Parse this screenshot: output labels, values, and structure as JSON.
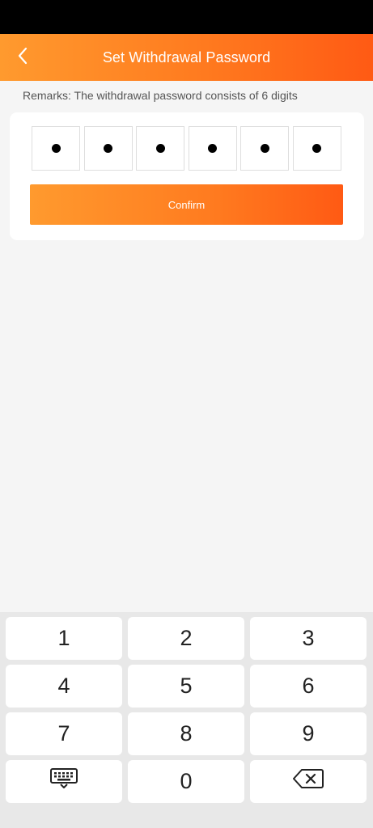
{
  "header": {
    "title": "Set Withdrawal Password"
  },
  "remarks": "Remarks: The withdrawal password consists of 6 digits",
  "pin": {
    "length": 6,
    "filled": 6,
    "mask_char": "●"
  },
  "confirm_label": "Confirm",
  "keypad": {
    "rows": [
      [
        "1",
        "2",
        "3"
      ],
      [
        "4",
        "5",
        "6"
      ],
      [
        "7",
        "8",
        "9"
      ],
      [
        "keyboard-icon",
        "0",
        "backspace-icon"
      ]
    ]
  },
  "colors": {
    "accent_start": "#ff9a2e",
    "accent_end": "#ff5a14",
    "background": "#f5f5f5",
    "keypad_bg": "#e8e8e8"
  }
}
